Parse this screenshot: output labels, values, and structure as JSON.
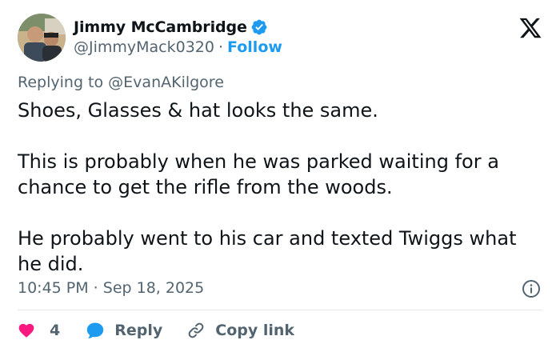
{
  "author": {
    "display_name": "Jimmy McCambridge",
    "handle": "@JimmyMack0320",
    "separator": "·",
    "follow_label": "Follow",
    "verified": true
  },
  "icons": {
    "platform_logo": "x-logo-icon",
    "verified": "verified-badge-icon",
    "info": "info-icon",
    "like": "heart-icon",
    "reply": "speech-bubble-icon",
    "copy_link": "link-icon"
  },
  "reply_context": {
    "prefix": "Replying to",
    "mention": "@EvanAKilgore"
  },
  "tweet": {
    "paragraphs": [
      "Shoes, Glasses & hat looks the same.",
      "This is probably when he was parked waiting for a chance to get the rifle from the woods.",
      "He probably went to his car and texted Twiggs what he did."
    ],
    "timestamp": "10:45 PM · Sep 18, 2025"
  },
  "actions": {
    "like_count": "4",
    "reply_label": "Reply",
    "copy_link_label": "Copy link"
  },
  "colors": {
    "text": "#0f1419",
    "secondary": "#536471",
    "accent": "#1d9bf0",
    "like": "#f91880",
    "divider": "#e4e8eb"
  }
}
